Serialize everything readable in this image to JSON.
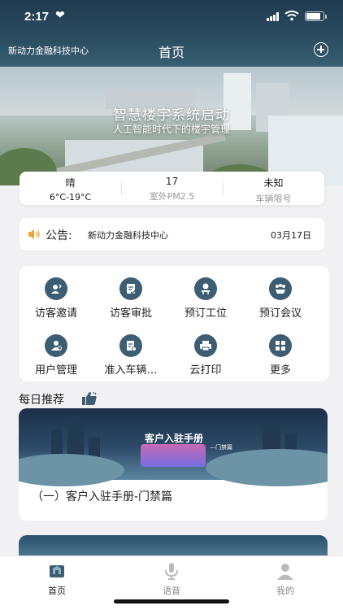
{
  "status": {
    "time": "2:17",
    "battery_level": 0.85
  },
  "nav": {
    "org": "新动力金融科技中心",
    "title": "首页"
  },
  "hero": {
    "headline": "智慧楼宇系统启动",
    "subline": "人工智能时代下的楼宇管理"
  },
  "weather": [
    {
      "top": "晴",
      "bottom": "6°C-19°C",
      "muted": false
    },
    {
      "top": "17",
      "bottom": "室外PM2.5",
      "muted": true
    },
    {
      "top": "未知",
      "bottom": "车辆限号",
      "muted": true
    }
  ],
  "notice": {
    "label": "公告:",
    "text": "新动力金融科技中心",
    "date": "03月17日"
  },
  "services": [
    {
      "label": "访客邀请",
      "icon": "visitor-invite-icon"
    },
    {
      "label": "访客审批",
      "icon": "visitor-approve-icon"
    },
    {
      "label": "预订工位",
      "icon": "book-desk-icon"
    },
    {
      "label": "预订会议",
      "icon": "book-meeting-icon"
    },
    {
      "label": "用户管理",
      "icon": "user-manage-icon"
    },
    {
      "label": "准入车辆…",
      "icon": "vehicle-access-icon"
    },
    {
      "label": "云打印",
      "icon": "cloud-print-icon"
    },
    {
      "label": "更多",
      "icon": "more-grid-icon"
    }
  ],
  "daily": {
    "title": "每日推荐",
    "card": {
      "banner_title": "客户入驻手册",
      "banner_sub": "—门禁篇",
      "caption": "（一）客户入驻手册-门禁篇"
    }
  },
  "tabbar": [
    {
      "label": "首页",
      "icon": "home-icon",
      "active": true
    },
    {
      "label": "语音",
      "icon": "microphone-icon",
      "active": false
    },
    {
      "label": "我的",
      "icon": "profile-icon",
      "active": false
    }
  ],
  "colors": {
    "header": "#1f3a4f",
    "icon_bg": "#3d5d72",
    "speaker": "#f0a23a",
    "background": "#f1f1f3"
  }
}
